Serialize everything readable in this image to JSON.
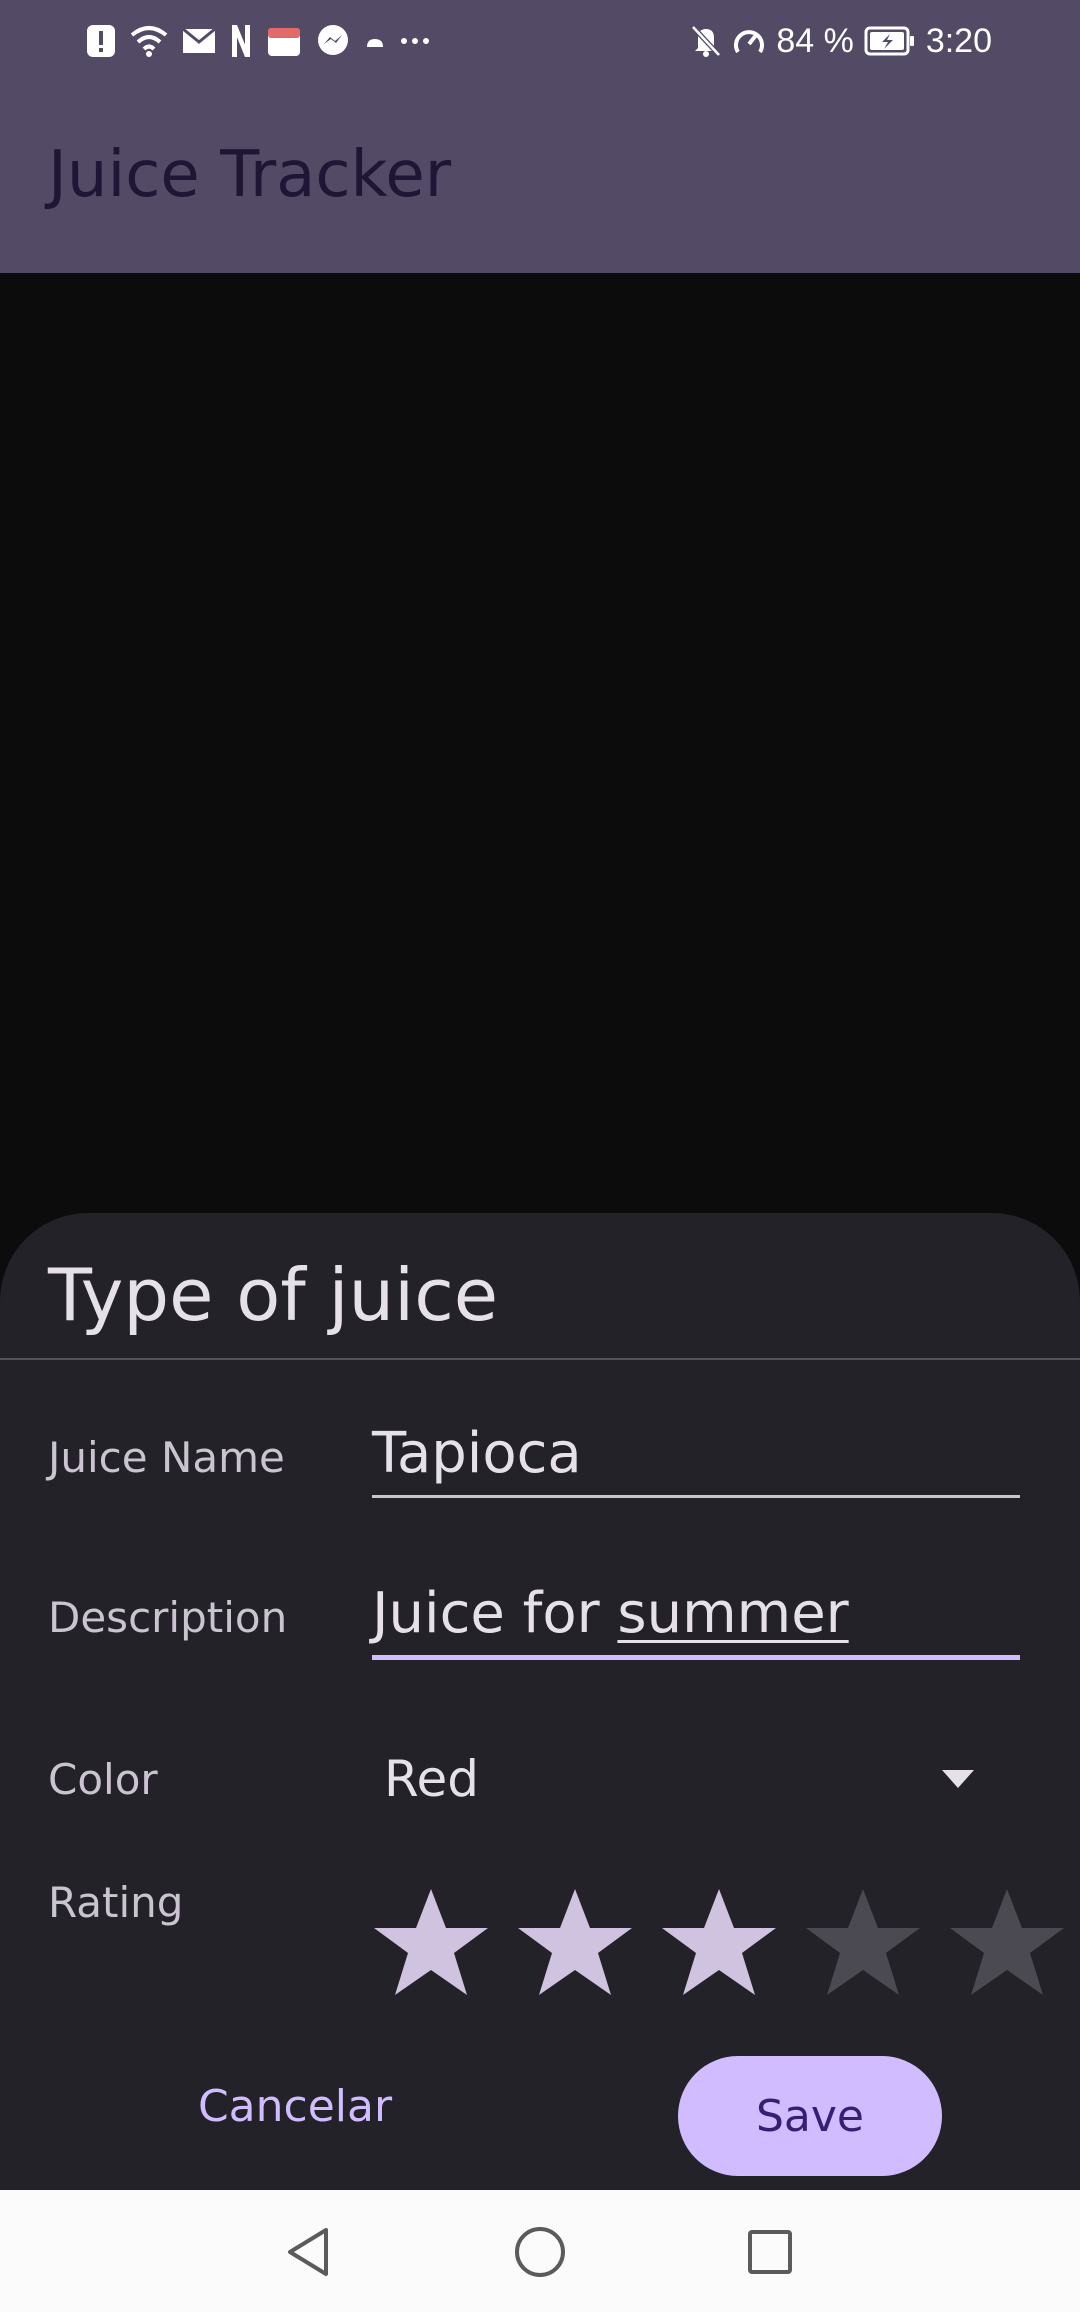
{
  "status_bar": {
    "battery": "84 %",
    "time": "3:20",
    "left_icons": [
      "alert-icon",
      "wifi-icon",
      "mail-icon",
      "netflix-icon",
      "store-icon",
      "messenger-icon",
      "cloud-icon",
      "more-dots-icon"
    ],
    "right_icons": [
      "bell-muted-icon",
      "speed-icon",
      "battery-icon"
    ]
  },
  "app_bar": {
    "title": "Juice Tracker"
  },
  "sheet": {
    "title": "Type of juice",
    "fields": {
      "name": {
        "label": "Juice Name",
        "value": "Tapioca"
      },
      "description": {
        "label": "Description",
        "value_prefix": "Juice for ",
        "value_underlined": "summer"
      },
      "color": {
        "label": "Color",
        "value": "Red"
      },
      "rating": {
        "label": "Rating",
        "value": 3,
        "max": 5
      }
    },
    "buttons": {
      "cancel": "Cancelar",
      "save": "Save"
    }
  },
  "colors": {
    "app_bar": "#534a66",
    "sheet": "#232228",
    "accent": "#d0bcff",
    "star_filled": "#cfc3e0",
    "star_empty": "#4b4951"
  }
}
